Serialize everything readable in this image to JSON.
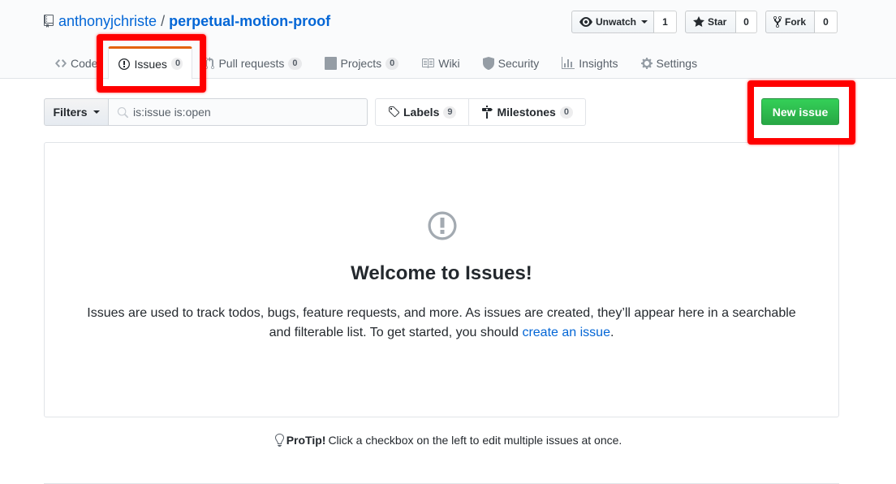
{
  "repo": {
    "owner": "anthonyjchriste",
    "separator": "/",
    "name": "perpetual-motion-proof"
  },
  "actions": {
    "watch_label": "Unwatch",
    "watch_count": "1",
    "star_label": "Star",
    "star_count": "0",
    "fork_label": "Fork",
    "fork_count": "0"
  },
  "nav": {
    "code": "Code",
    "issues": "Issues",
    "issues_count": "0",
    "pulls": "Pull requests",
    "pulls_count": "0",
    "projects": "Projects",
    "projects_count": "0",
    "wiki": "Wiki",
    "security": "Security",
    "insights": "Insights",
    "settings": "Settings",
    "selected": "Issues"
  },
  "subnav": {
    "filters_label": "Filters",
    "search_value": "is:issue is:open",
    "labels_label": "Labels",
    "labels_count": "9",
    "milestones_label": "Milestones",
    "milestones_count": "0",
    "new_issue_label": "New issue"
  },
  "blankslate": {
    "icon": "issue-opened-icon",
    "title": "Welcome to Issues!",
    "text_before_link": "Issues are used to track todos, bugs, feature requests, and more. As issues are created, they’ll appear here in a searchable and filterable list. To get started, you should ",
    "link_text": "create an issue",
    "text_after_link": "."
  },
  "protip": {
    "icon": "light-bulb-icon",
    "label": "ProTip!",
    "text": "Click a checkbox on the left to edit multiple issues at once."
  },
  "colors": {
    "link": "#0366d6",
    "primary_button": "#28a745",
    "selected_tab_accent": "#e36209",
    "highlight": "#ff0000"
  }
}
